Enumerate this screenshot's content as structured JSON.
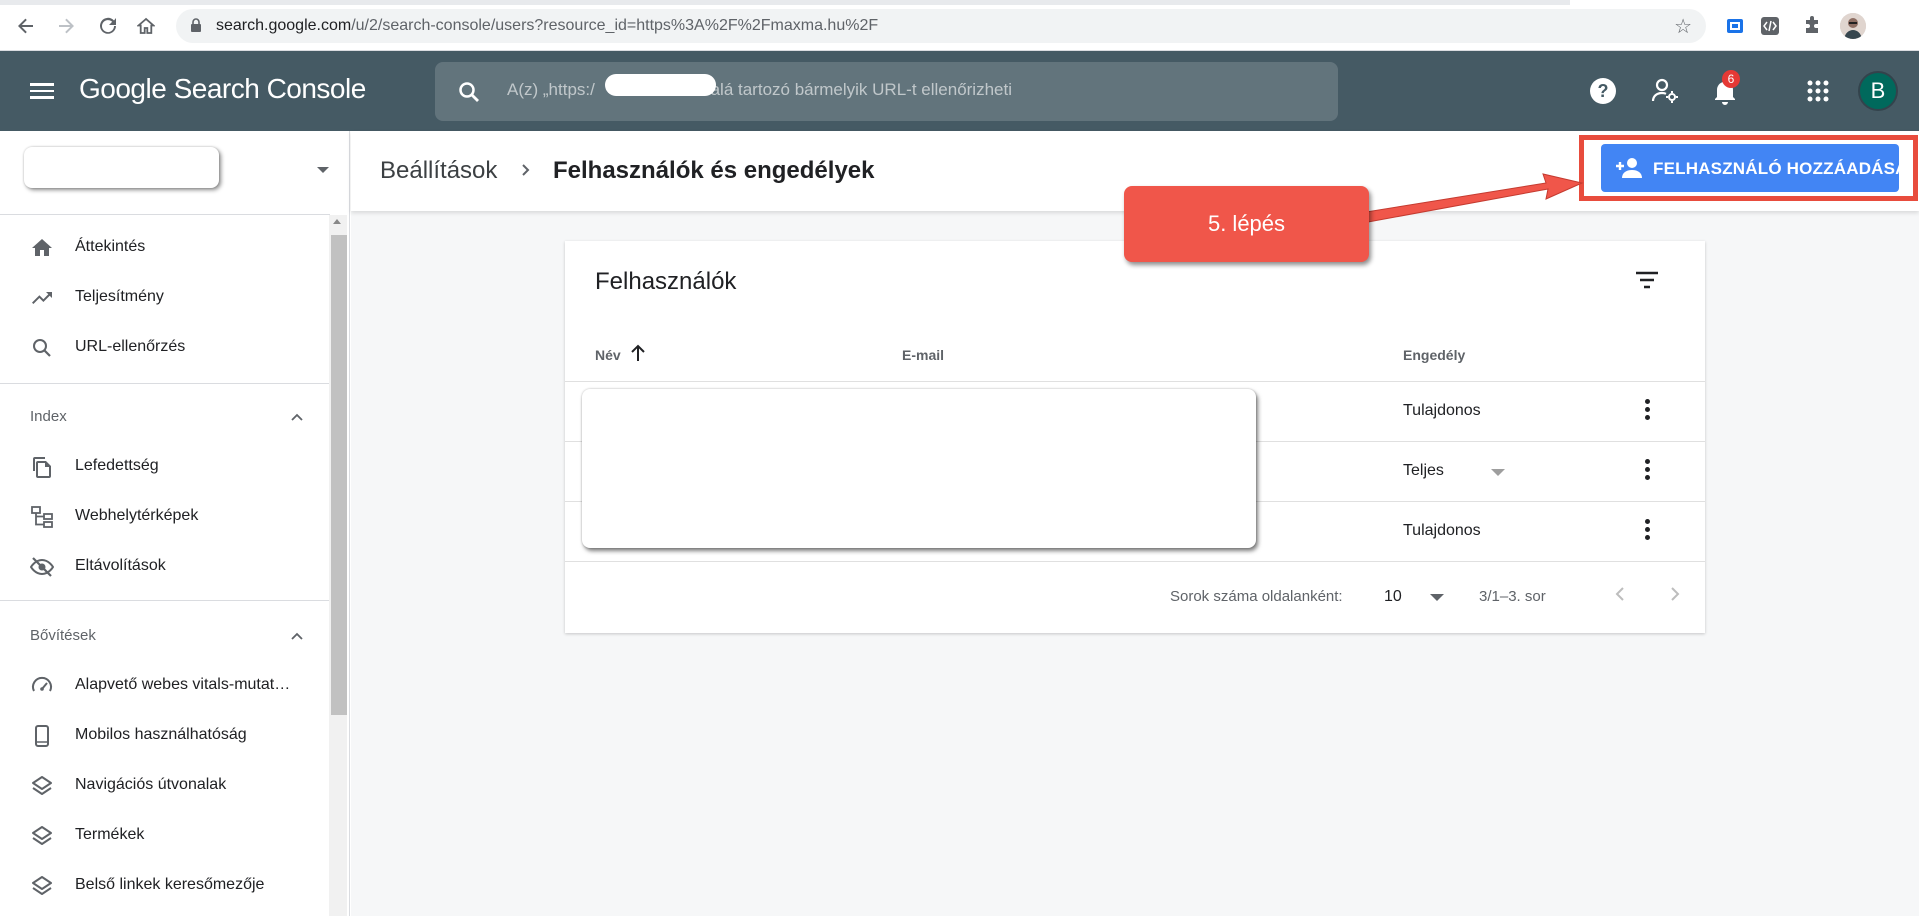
{
  "browser": {
    "url_host": "search.google.com",
    "url_path": "/u/2/search-console/users?resource_id=https%3A%2F%2Fmaxma.hu%2F"
  },
  "header": {
    "logo_text": "Google Search Console",
    "search_placeholder_prefix": "A(z) „https:/",
    "search_placeholder_suffix": "alá tartozó bármelyik URL-t ellenőrizheti",
    "notification_count": "6",
    "avatar_letter": "B"
  },
  "sidebar": {
    "items_top": [
      {
        "label": "Áttekintés",
        "icon": "home-icon"
      },
      {
        "label": "Teljesítmény",
        "icon": "trending-up-icon"
      },
      {
        "label": "URL-ellenőrzés",
        "icon": "search-icon"
      }
    ],
    "section_index": {
      "title": "Index",
      "items": [
        {
          "label": "Lefedettség",
          "icon": "copy-icon"
        },
        {
          "label": "Webhelytérképek",
          "icon": "sitemap-icon"
        },
        {
          "label": "Eltávolítások",
          "icon": "eye-off-icon"
        }
      ]
    },
    "section_enh": {
      "title": "Bővítések",
      "items": [
        {
          "label": "Alapvető webes vitals-mutat…",
          "icon": "speed-icon"
        },
        {
          "label": "Mobilos használhatóság",
          "icon": "phone-icon"
        },
        {
          "label": "Navigációs útvonalak",
          "icon": "layers-icon"
        },
        {
          "label": "Termékek",
          "icon": "layers-icon"
        },
        {
          "label": "Belső linkek keresőmezője",
          "icon": "layers-icon"
        }
      ]
    }
  },
  "page": {
    "breadcrumb_parent": "Beállítások",
    "breadcrumb_current": "Felhasználók és engedélyek",
    "add_user_label": "FELHASZNÁLÓ HOZZÁADÁSA"
  },
  "card": {
    "title": "Felhasználók",
    "columns": {
      "name": "Név",
      "email": "E-mail",
      "permission": "Engedély"
    },
    "rows": [
      {
        "permission": "Tulajdonos"
      },
      {
        "permission": "Teljes"
      },
      {
        "permission": "Tulajdonos"
      }
    ],
    "footer": {
      "rows_per_page_label": "Sorok száma oldalanként:",
      "rows_per_page_value": "10",
      "range": "3/1–3. sor"
    }
  },
  "callout": {
    "text": "5. lépés"
  },
  "colors": {
    "header_bg": "#455a64",
    "accent_blue": "#4285f4",
    "callout_red": "#f0564a",
    "highlight_red": "#e84c3d",
    "avatar_green": "#00695c"
  }
}
